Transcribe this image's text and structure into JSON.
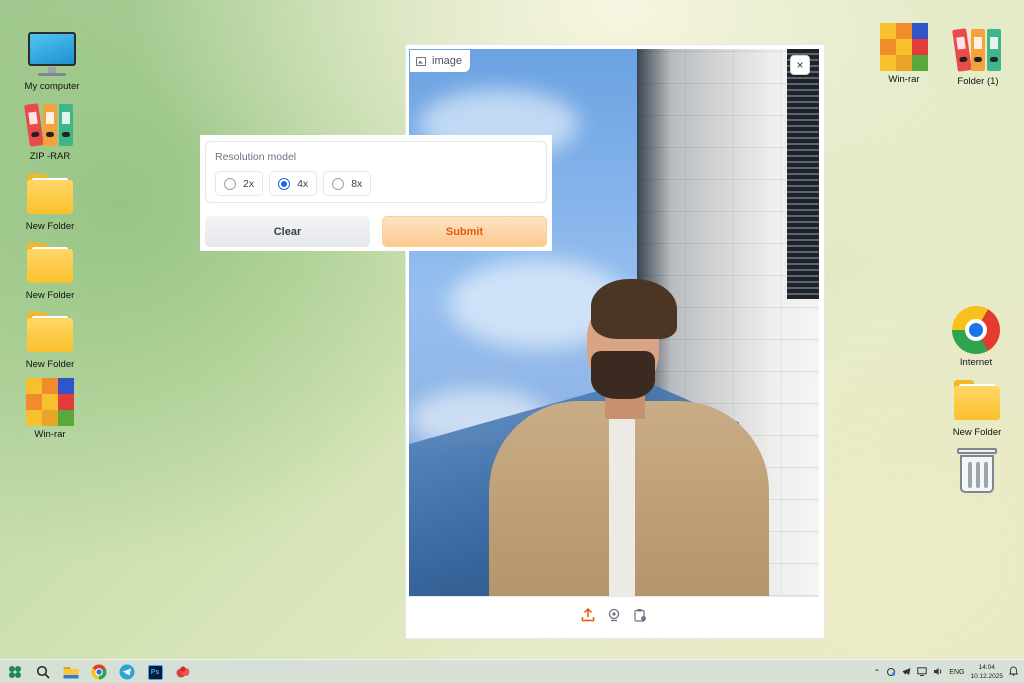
{
  "desktop_left": [
    {
      "id": "my-computer",
      "label": "My computer"
    },
    {
      "id": "zip-rar",
      "label": "ZIP -RAR"
    },
    {
      "id": "new-folder-1",
      "label": "New Folder"
    },
    {
      "id": "new-folder-2",
      "label": "New Folder"
    },
    {
      "id": "new-folder-3",
      "label": "New Folder"
    },
    {
      "id": "win-rar-left",
      "label": "Win-rar"
    }
  ],
  "desktop_right": [
    {
      "id": "win-rar-right",
      "label": "Win-rar"
    },
    {
      "id": "folder-1",
      "label": "Folder (1)"
    },
    {
      "id": "internet",
      "label": "Internet"
    },
    {
      "id": "new-folder-right",
      "label": "New Folder"
    },
    {
      "id": "recycle-bin",
      "label": ""
    }
  ],
  "image_panel": {
    "label": "image",
    "label_icon": "image-icon",
    "close_glyph": "×",
    "toolbar_icons": [
      "upload-icon",
      "webcam-icon",
      "clipboard-icon"
    ]
  },
  "resolution_panel": {
    "title": "Resolution model",
    "options": [
      "2x",
      "4x",
      "8x"
    ],
    "selected": "4x",
    "clear_label": "Clear",
    "submit_label": "Submit"
  },
  "taskbar": {
    "apps": [
      "windows-start-icon",
      "search-icon",
      "file-explorer-icon",
      "chrome-icon",
      "telegram-icon",
      "photoshop-icon",
      "app-icon"
    ],
    "photoshop_text": "Ps",
    "language": "ENG",
    "time": "14:04",
    "date": "10.12.2025"
  },
  "colors": {
    "accent_blue": "#2563eb",
    "submit_orange": "#ea580c"
  }
}
